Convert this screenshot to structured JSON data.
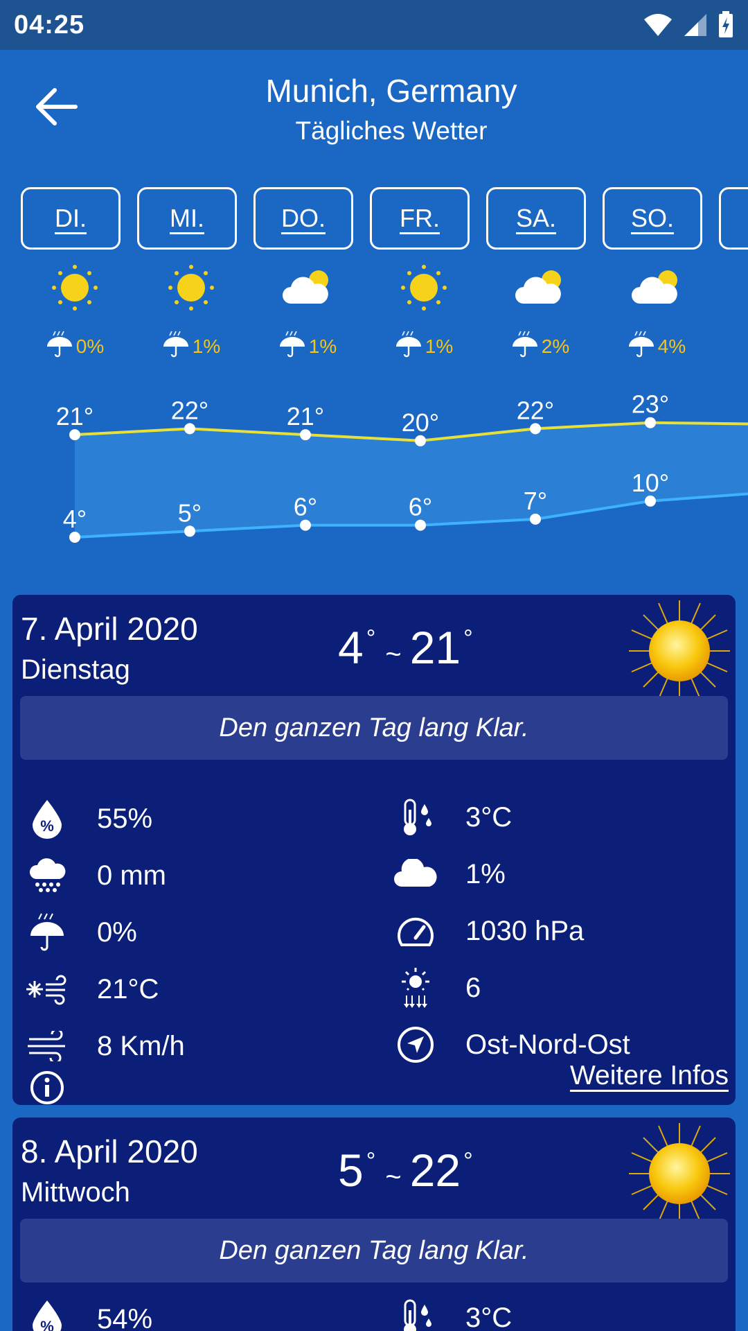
{
  "status": {
    "time": "04:25",
    "icons": [
      "wifi-icon",
      "signal-icon",
      "battery-charging-icon"
    ]
  },
  "header": {
    "title": "Munich, Germany",
    "subtitle": "Tägliches Wetter",
    "back_icon": "arrow-left-icon"
  },
  "days": [
    {
      "tab": "DI.",
      "icon": "sun",
      "rain": "0%"
    },
    {
      "tab": "MI.",
      "icon": "sun",
      "rain": "1%"
    },
    {
      "tab": "DO.",
      "icon": "cloud-sun",
      "rain": "1%"
    },
    {
      "tab": "FR.",
      "icon": "sun",
      "rain": "1%"
    },
    {
      "tab": "SA.",
      "icon": "cloud-sun",
      "rain": "2%"
    },
    {
      "tab": "SO.",
      "icon": "cloud-sun",
      "rain": "4%"
    }
  ],
  "chart_data": {
    "type": "line",
    "series": [
      {
        "values": [
          21,
          22,
          21,
          20,
          22,
          23
        ],
        "color": "#e8e03a"
      },
      {
        "values": [
          4,
          5,
          6,
          6,
          7,
          10
        ],
        "color": "#3fb2ff"
      }
    ],
    "labels_high": [
      "21°",
      "22°",
      "21°",
      "20°",
      "22°",
      "23°"
    ],
    "labels_low": [
      "4°",
      "5°",
      "6°",
      "6°",
      "7°",
      "10°"
    ]
  },
  "cards": [
    {
      "date": "7. April 2020",
      "weekday": "Dienstag",
      "low": "4",
      "high": "21",
      "tilde": "~",
      "deg": "°",
      "summary": "Den ganzen Tag lang Klar.",
      "details_left": [
        {
          "icon": "humidity-icon",
          "value": "55%"
        },
        {
          "icon": "precipitation-icon",
          "value": "0 mm"
        },
        {
          "icon": "rain-chance-icon",
          "value": "0%"
        },
        {
          "icon": "feels-like-icon",
          "value": "21°C"
        },
        {
          "icon": "wind-icon",
          "value": "8 Km/h"
        }
      ],
      "details_right": [
        {
          "icon": "dew-point-icon",
          "value": "3°C"
        },
        {
          "icon": "cloud-cover-icon",
          "value": "1%"
        },
        {
          "icon": "pressure-icon",
          "value": "1030 hPa"
        },
        {
          "icon": "uv-index-icon",
          "value": "6"
        },
        {
          "icon": "wind-direction-icon",
          "value": "Ost-Nord-Ost"
        }
      ],
      "more_label": "Weitere Infos"
    },
    {
      "date": "8. April 2020",
      "weekday": "Mittwoch",
      "low": "5",
      "high": "22",
      "tilde": "~",
      "deg": "°",
      "summary": "Den ganzen Tag lang Klar.",
      "details_left": [
        {
          "icon": "humidity-icon",
          "value": "54%"
        }
      ],
      "details_right": [
        {
          "icon": "dew-point-icon",
          "value": "3°C"
        }
      ]
    }
  ]
}
